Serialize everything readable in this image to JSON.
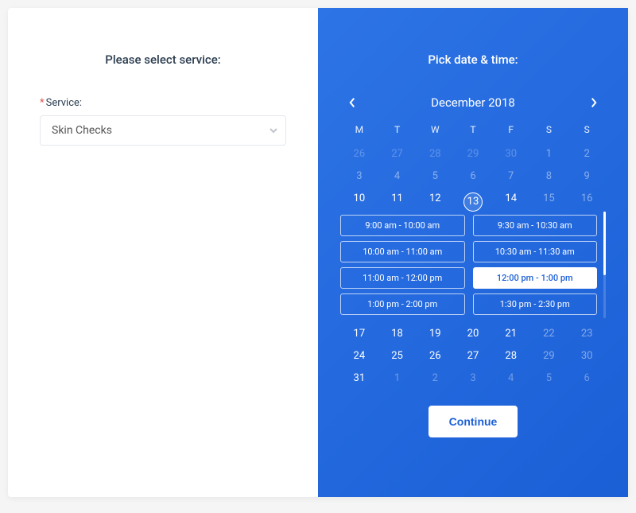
{
  "left": {
    "heading": "Please select service:",
    "serviceLabel": "Service:",
    "serviceValue": "Skin Checks"
  },
  "right": {
    "heading": "Pick date & time:",
    "month": "December 2018",
    "dow": [
      "M",
      "T",
      "W",
      "T",
      "F",
      "S",
      "S"
    ],
    "weeks": [
      [
        {
          "d": "26",
          "other": true,
          "disabled": true
        },
        {
          "d": "27",
          "other": true,
          "disabled": true
        },
        {
          "d": "28",
          "other": true,
          "disabled": true
        },
        {
          "d": "29",
          "other": true,
          "disabled": true
        },
        {
          "d": "30",
          "other": true,
          "disabled": true
        },
        {
          "d": "1",
          "disabled": true
        },
        {
          "d": "2",
          "disabled": true
        }
      ],
      [
        {
          "d": "3",
          "disabled": true
        },
        {
          "d": "4",
          "disabled": true
        },
        {
          "d": "5",
          "disabled": true
        },
        {
          "d": "6",
          "disabled": true
        },
        {
          "d": "7",
          "disabled": true
        },
        {
          "d": "8",
          "disabled": true
        },
        {
          "d": "9",
          "disabled": true
        }
      ],
      [
        {
          "d": "10"
        },
        {
          "d": "11"
        },
        {
          "d": "12"
        },
        {
          "d": "13",
          "selected": true
        },
        {
          "d": "14"
        },
        {
          "d": "15",
          "disabled": true
        },
        {
          "d": "16",
          "disabled": true
        }
      ],
      [
        {
          "d": "17"
        },
        {
          "d": "18"
        },
        {
          "d": "19"
        },
        {
          "d": "20"
        },
        {
          "d": "21"
        },
        {
          "d": "22",
          "disabled": true
        },
        {
          "d": "23",
          "disabled": true
        }
      ],
      [
        {
          "d": "24"
        },
        {
          "d": "25"
        },
        {
          "d": "26"
        },
        {
          "d": "27"
        },
        {
          "d": "28"
        },
        {
          "d": "29",
          "disabled": true
        },
        {
          "d": "30",
          "disabled": true
        }
      ],
      [
        {
          "d": "31"
        },
        {
          "d": "1",
          "other": true
        },
        {
          "d": "2",
          "other": true
        },
        {
          "d": "3",
          "other": true
        },
        {
          "d": "4",
          "other": true
        },
        {
          "d": "5",
          "other": true
        },
        {
          "d": "6",
          "other": true
        }
      ]
    ],
    "slots": [
      {
        "label": "9:00 am - 10:00 am"
      },
      {
        "label": "9:30 am - 10:30 am"
      },
      {
        "label": "10:00 am - 11:00 am"
      },
      {
        "label": "10:30 am - 11:30 am"
      },
      {
        "label": "11:00 am - 12:00 pm"
      },
      {
        "label": "12:00 pm - 1:00 pm",
        "selected": true
      },
      {
        "label": "1:00 pm - 2:00 pm"
      },
      {
        "label": "1:30 pm - 2:30 pm"
      }
    ],
    "continue": "Continue"
  }
}
